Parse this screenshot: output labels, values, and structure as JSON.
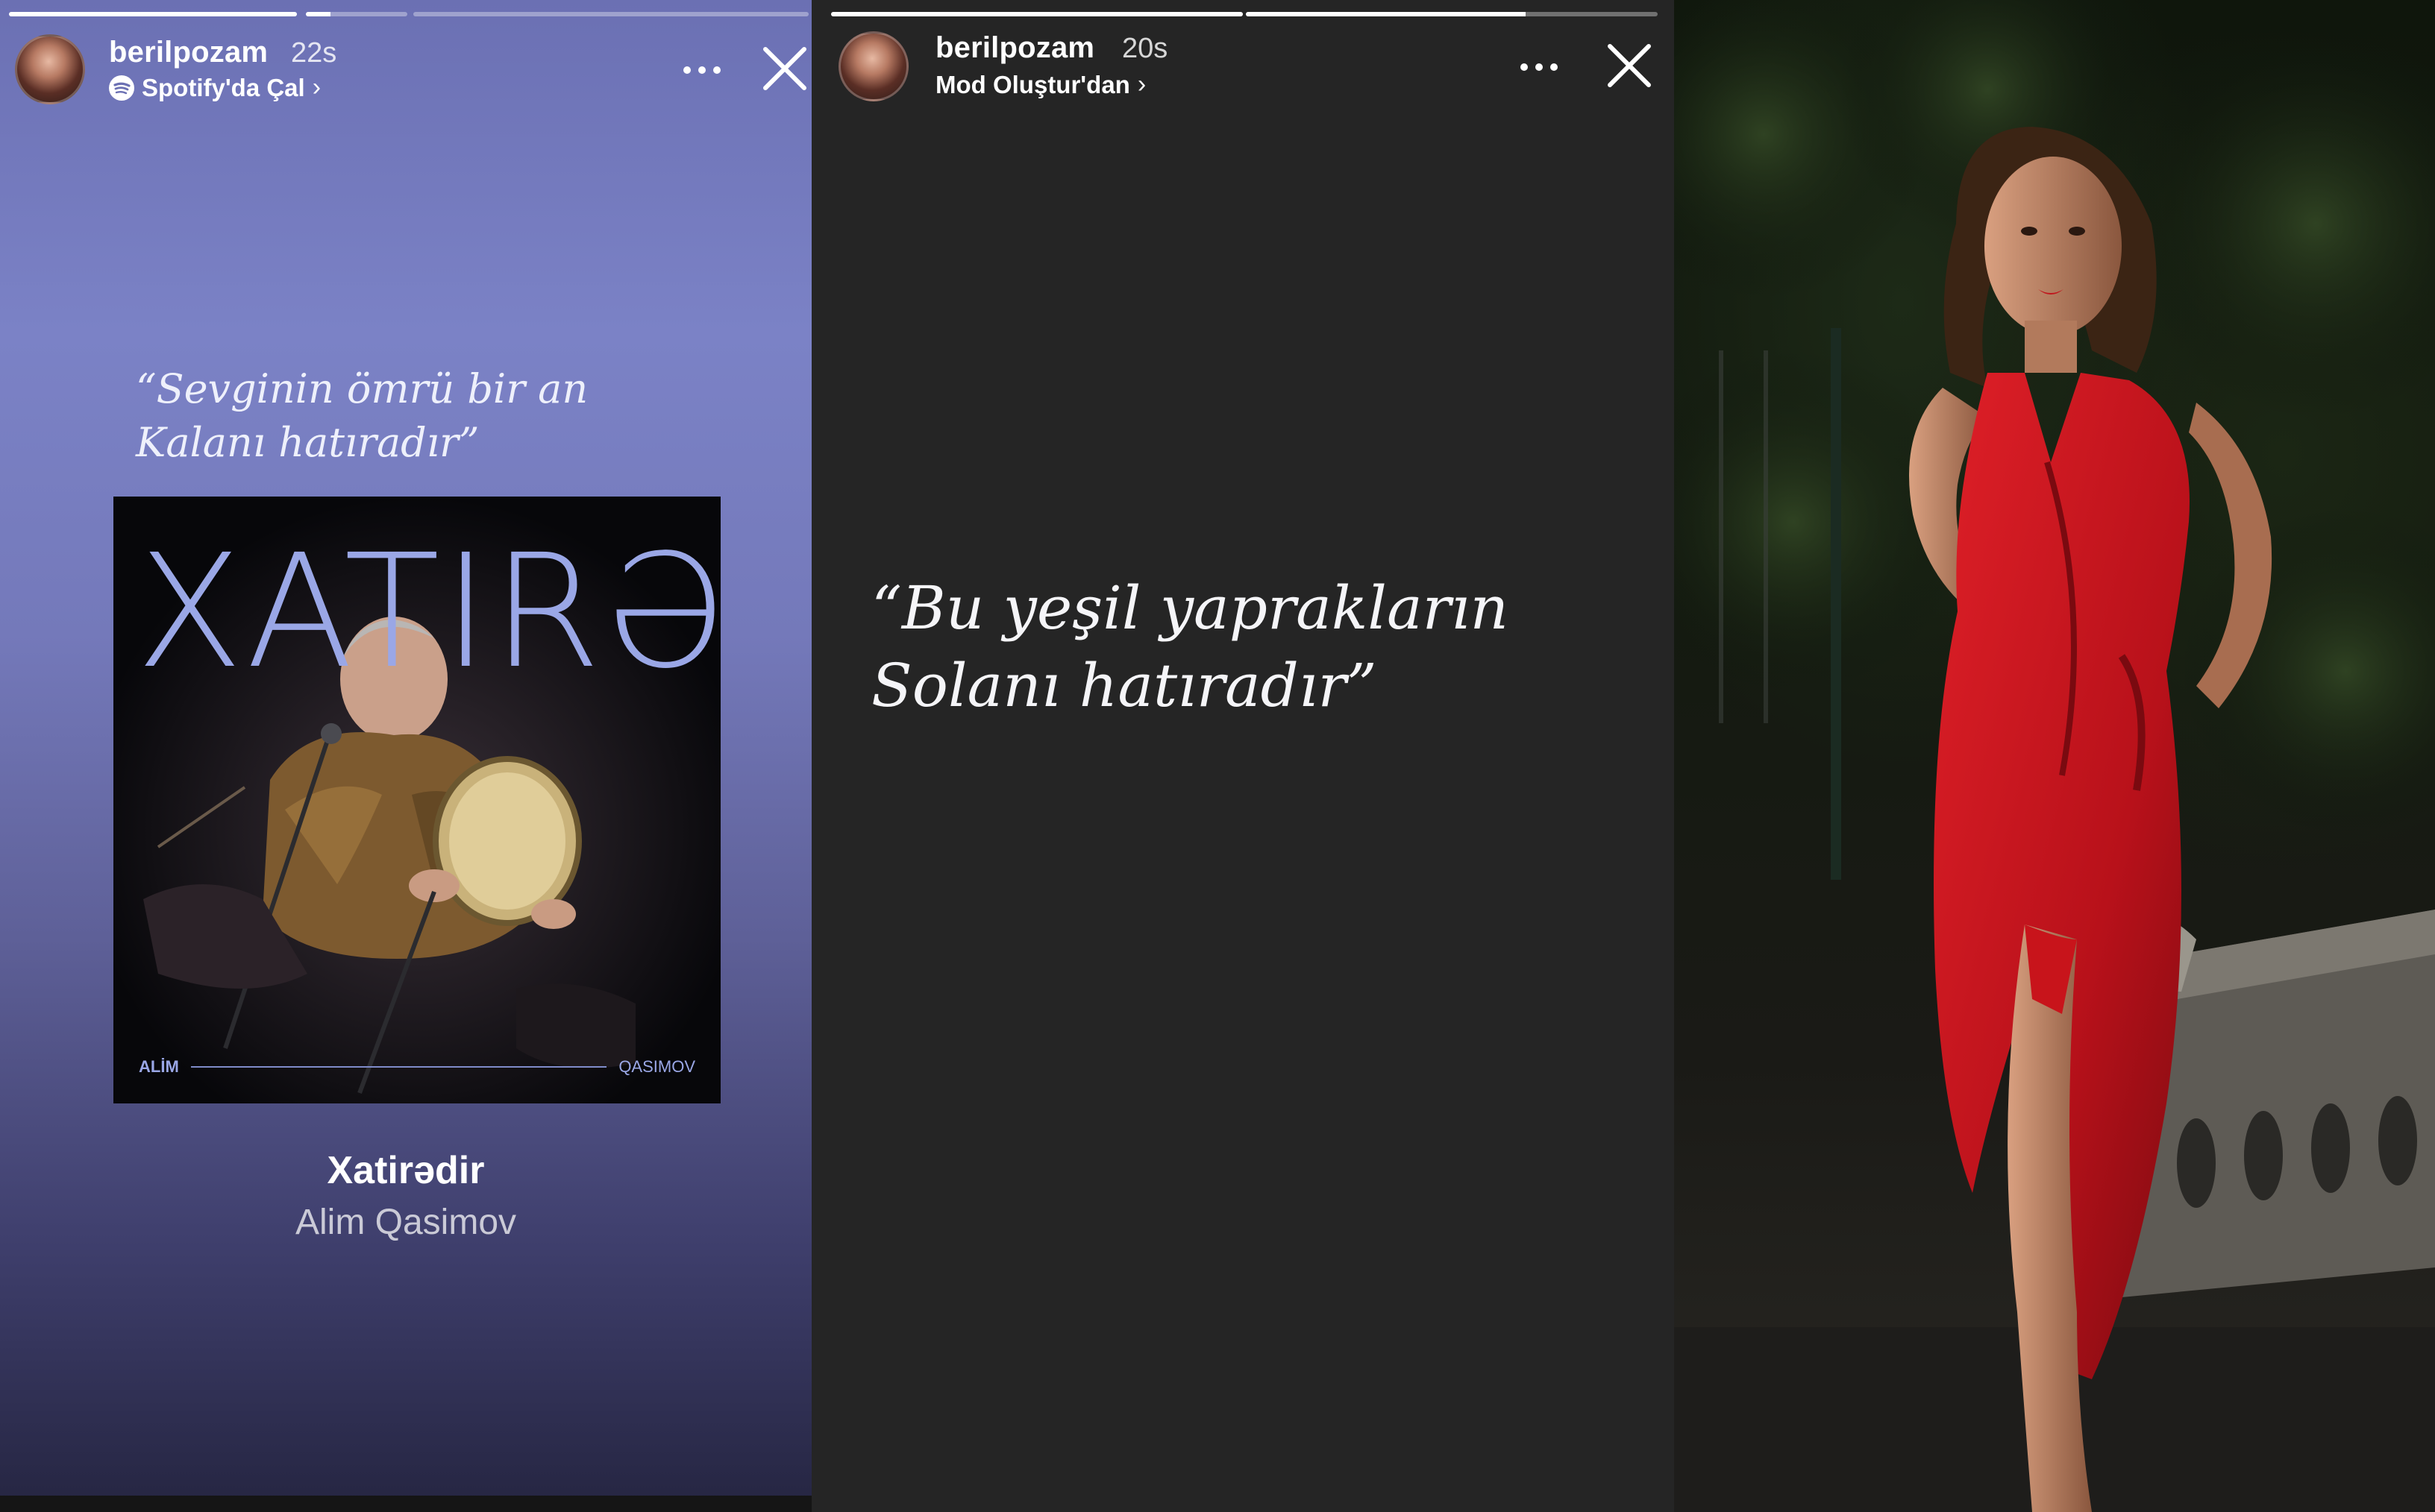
{
  "story_1": {
    "progress": [
      1.0,
      0.24,
      0.0
    ],
    "username": "berilpozam",
    "time": "22s",
    "subtitle": "Spotify'da Çal",
    "quote_lines": [
      "“Sevginin ömrü bir an",
      "Kalanı hatıradır”"
    ],
    "album": {
      "cover_title": "XATIRƏDIR",
      "footer_left": "ALİM",
      "footer_right": "QASIMOV"
    },
    "track_title": "Xatirədir",
    "track_artist": "Alim Qasimov",
    "icons": [
      "spotify-icon",
      "more-icon",
      "close-icon"
    ]
  },
  "story_2": {
    "progress": [
      1.0,
      0.68
    ],
    "username": "berilpozam",
    "time": "20s",
    "subtitle": "Mod Oluştur'dan",
    "quote_lines": [
      "“Bu yeşil yaprakların",
      "Solanı hatıradır”"
    ],
    "icons": [
      "more-icon",
      "close-icon"
    ]
  },
  "colors": {
    "story_1_gradient_top": "#6b70b3",
    "story_1_gradient_bottom": "#252541",
    "story_2_background": "#252525",
    "album_text": "#9aa7e6",
    "dress": "#c8141b"
  }
}
